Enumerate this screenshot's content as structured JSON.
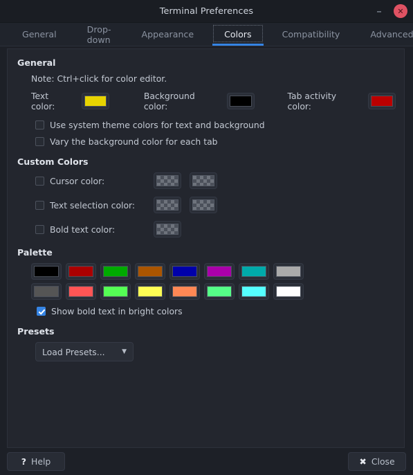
{
  "window": {
    "title": "Terminal Preferences",
    "minimize_label": "–",
    "close_label": "✕"
  },
  "tabs": [
    {
      "label": "General",
      "active": false
    },
    {
      "label": "Drop-down",
      "active": false
    },
    {
      "label": "Appearance",
      "active": false
    },
    {
      "label": "Colors",
      "active": true
    },
    {
      "label": "Compatibility",
      "active": false
    },
    {
      "label": "Advanced",
      "active": false
    }
  ],
  "general": {
    "heading": "General",
    "note": "Note: Ctrl+click for color editor.",
    "text_color_label": "Text color:",
    "text_color_value": "#e8d400",
    "background_color_label": "Background color:",
    "background_color_value": "#000000",
    "tab_activity_color_label": "Tab activity color:",
    "tab_activity_color_value": "#bb0000",
    "checkbox_system_theme": "Use system theme colors for text and background",
    "checkbox_vary_background": "Vary the background color for each tab"
  },
  "custom_colors": {
    "heading": "Custom Colors",
    "cursor_label": "Cursor color:",
    "text_selection_label": "Text selection color:",
    "bold_text_label": "Bold text color:"
  },
  "palette": {
    "heading": "Palette",
    "row1": [
      "#000000",
      "#aa0000",
      "#00aa00",
      "#aa5500",
      "#0000aa",
      "#aa00aa",
      "#00aaaa",
      "#aaaaaa"
    ],
    "row2": [
      "#555555",
      "#ff5555",
      "#55ff55",
      "#ffff55",
      "#ff8855",
      "#55ff88",
      "#55ffff",
      "#ffffff"
    ],
    "bold_bright_checkbox": "Show bold text in bright colors"
  },
  "presets": {
    "heading": "Presets",
    "load_label": "Load Presets...",
    "caret": "▼"
  },
  "footer": {
    "help_icon": "?",
    "help_label": "Help",
    "close_icon": "✖",
    "close_label": "Close"
  },
  "accent": "#3584e4"
}
